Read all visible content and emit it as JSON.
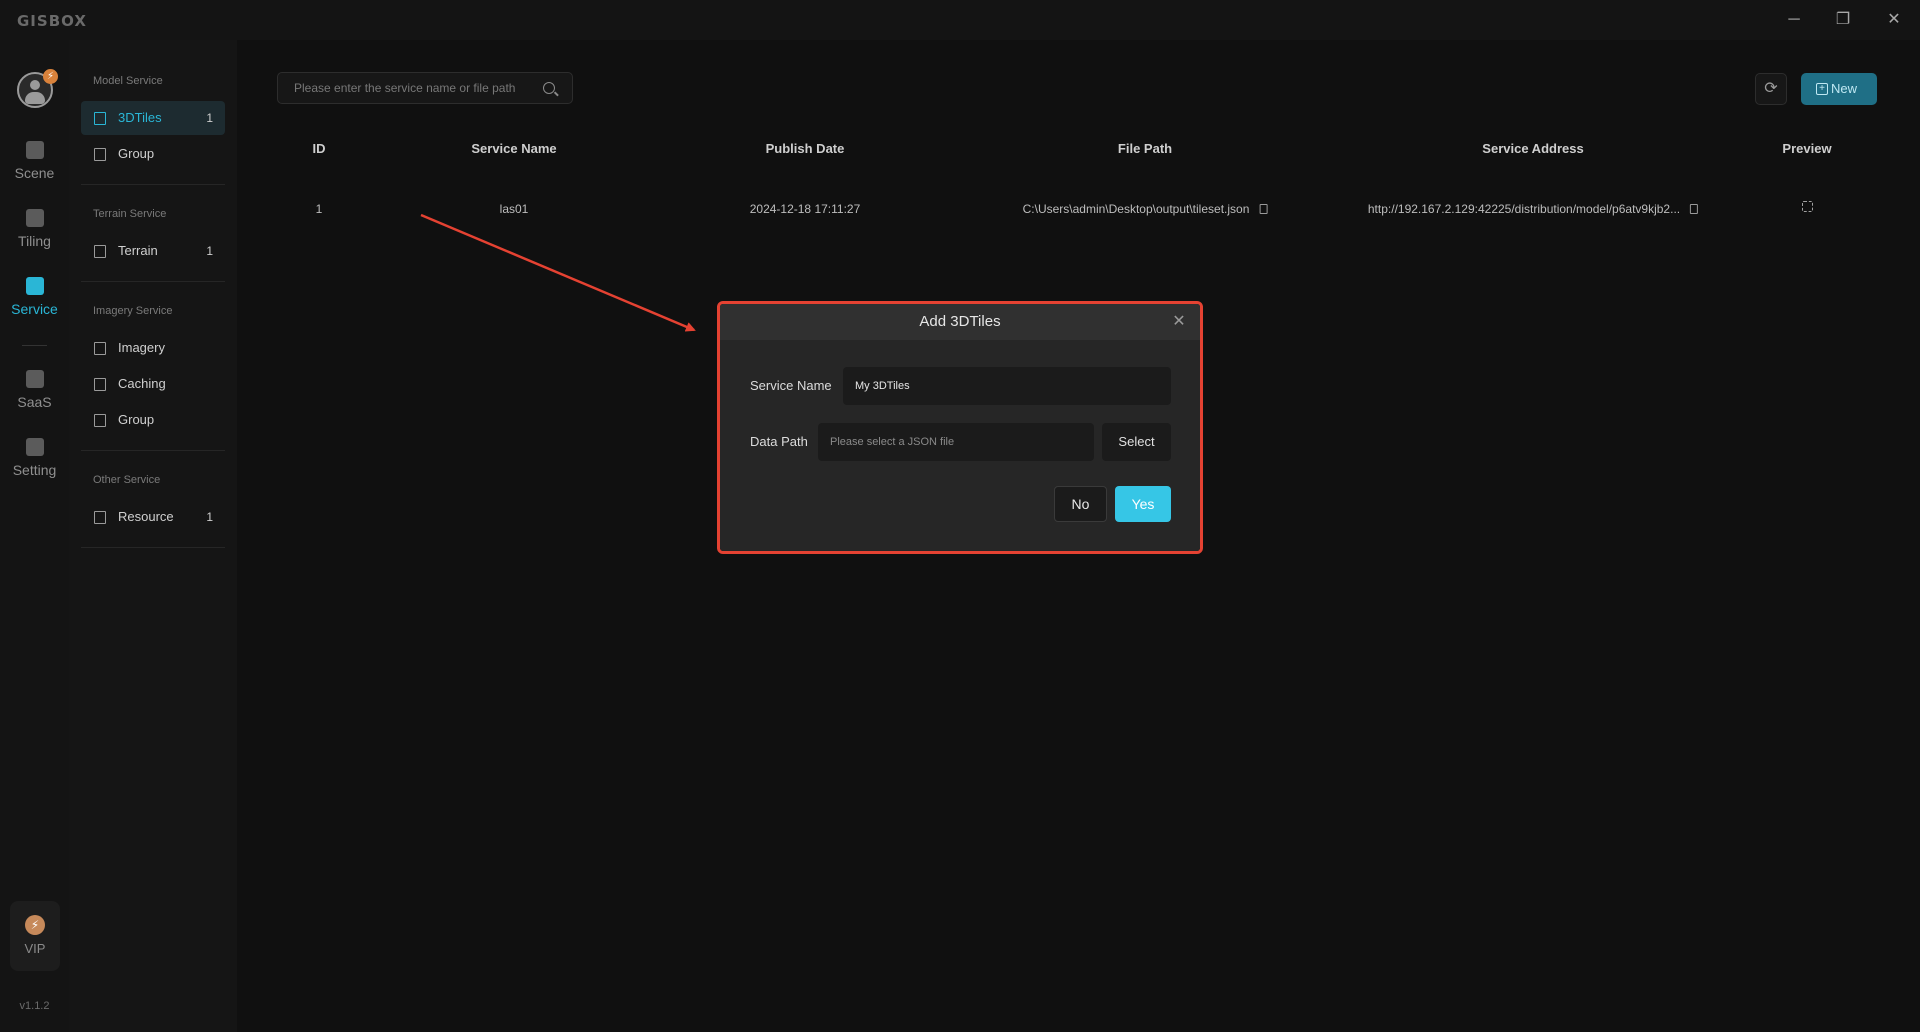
{
  "app": {
    "brand": "GISBOX",
    "version": "v1.1.2",
    "accent": "#2ab6d6"
  },
  "window_controls": {
    "minimize": "─",
    "restore": "❐",
    "close": "✕"
  },
  "rail": {
    "items": [
      {
        "label": "Scene",
        "icon": "scene-icon"
      },
      {
        "label": "Tiling",
        "icon": "tiling-icon"
      },
      {
        "label": "Service",
        "icon": "service-icon",
        "active": true
      },
      {
        "label": "SaaS",
        "icon": "saas-icon"
      },
      {
        "label": "Setting",
        "icon": "setting-icon"
      }
    ],
    "vip_label": "VIP",
    "vip_glyph": "⚡",
    "badge_glyph": "⚡"
  },
  "subnav": {
    "groups": [
      {
        "title": "Model Service",
        "items": [
          {
            "label": "3DTiles",
            "count": "1"
          },
          {
            "label": "Group",
            "count": ""
          }
        ]
      },
      {
        "title": "Terrain Service",
        "items": [
          {
            "label": "Terrain",
            "count": "1"
          }
        ]
      },
      {
        "title": "Imagery Service",
        "items": [
          {
            "label": "Imagery",
            "count": ""
          },
          {
            "label": "Caching",
            "count": ""
          },
          {
            "label": "Group",
            "count": ""
          }
        ]
      },
      {
        "title": "Other Service",
        "items": [
          {
            "label": "Resource",
            "count": "1"
          }
        ]
      }
    ]
  },
  "toolbar": {
    "search_placeholder": "Please enter the service name or file path",
    "refresh_glyph": "⟳",
    "new_label": "New",
    "new_glyph": "+"
  },
  "table": {
    "headers": [
      "ID",
      "Service Name",
      "Publish Date",
      "File Path",
      "Service Address",
      "Preview"
    ],
    "rows": [
      {
        "id": "1",
        "name": "las01",
        "date": "2024-12-18 17:11:27",
        "path": "C:\\Users\\admin\\Desktop\\output\\tileset.json",
        "address": "http://192.167.2.129:42225/distribution/model/p6atv9kjb2..."
      }
    ]
  },
  "dialog": {
    "title": "Add 3DTiles",
    "close_glyph": "✕",
    "service_name_label": "Service Name",
    "service_name_value": "My 3DTiles",
    "data_path_label": "Data Path",
    "data_path_placeholder": "Please select a JSON file",
    "select_label": "Select",
    "no_label": "No",
    "yes_label": "Yes",
    "highlight_color": "#e54232"
  }
}
